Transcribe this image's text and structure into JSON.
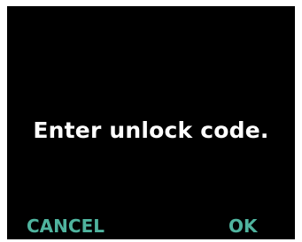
{
  "screen": {
    "message": "Enter unlock code."
  },
  "softkeys": {
    "left_label": "CANCEL",
    "right_label": "OK"
  },
  "colors": {
    "background": "#000000",
    "text": "#ffffff",
    "softkey": "#4fb39e"
  }
}
